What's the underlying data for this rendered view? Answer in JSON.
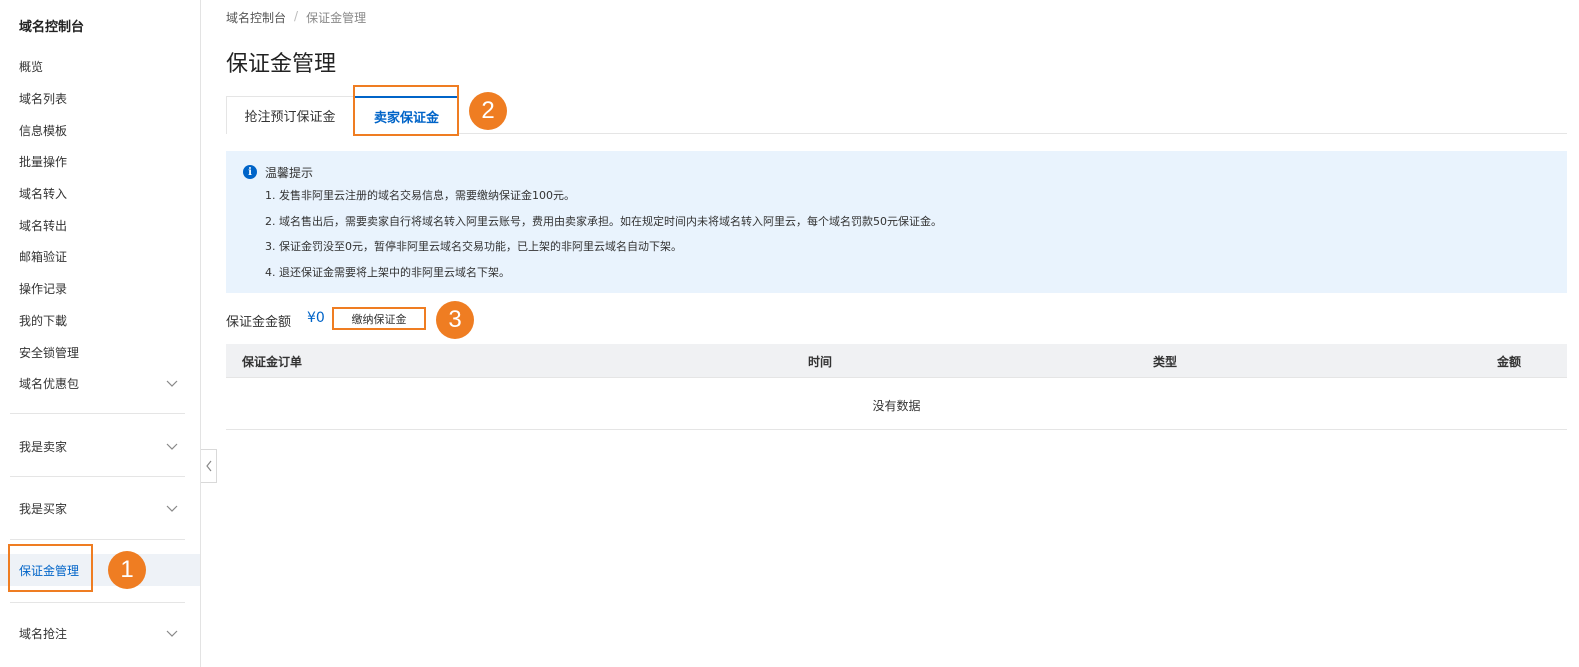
{
  "sidebar": {
    "title": "域名控制台",
    "items": [
      {
        "label": "概览"
      },
      {
        "label": "域名列表"
      },
      {
        "label": "信息模板"
      },
      {
        "label": "批量操作"
      },
      {
        "label": "域名转入"
      },
      {
        "label": "域名转出"
      },
      {
        "label": "邮箱验证"
      },
      {
        "label": "操作记录"
      },
      {
        "label": "我的下載"
      },
      {
        "label": "安全锁管理"
      },
      {
        "label": "域名优惠包"
      }
    ],
    "groups": [
      {
        "label": "我是卖家"
      },
      {
        "label": "我是买家"
      },
      {
        "label": "保证金管理"
      },
      {
        "label": "域名抢注"
      }
    ]
  },
  "breadcrumb": {
    "root": "域名控制台",
    "sep": "/",
    "current": "保证金管理"
  },
  "page_title": "保证金管理",
  "tabs": [
    {
      "label": "抢注预订保证金"
    },
    {
      "label": "卖家保证金"
    }
  ],
  "notice": {
    "title": "温馨提示",
    "lines": [
      "1. 发售非阿里云注册的域名交易信息，需要缴纳保证金100元。",
      "2. 域名售出后，需要卖家自行将域名转入阿里云账号，费用由卖家承担。如在规定时间内未将域名转入阿里云，每个域名罚款50元保证金。",
      "3. 保证金罚没至0元，暂停非阿里云域名交易功能，已上架的非阿里云域名自动下架。",
      "4. 退还保证金需要将上架中的非阿里云域名下架。"
    ]
  },
  "deposit": {
    "label": "保证金金额",
    "value": "¥0",
    "pay_button": "缴纳保证金"
  },
  "table": {
    "headers": [
      "保证金订单",
      "时间",
      "类型",
      "金额"
    ],
    "empty_text": "没有数据"
  },
  "callouts": [
    "1",
    "2",
    "3"
  ],
  "colors": {
    "accent": "#0064c8",
    "highlight": "#ef7d22",
    "notice_bg": "#e9f3fd"
  }
}
